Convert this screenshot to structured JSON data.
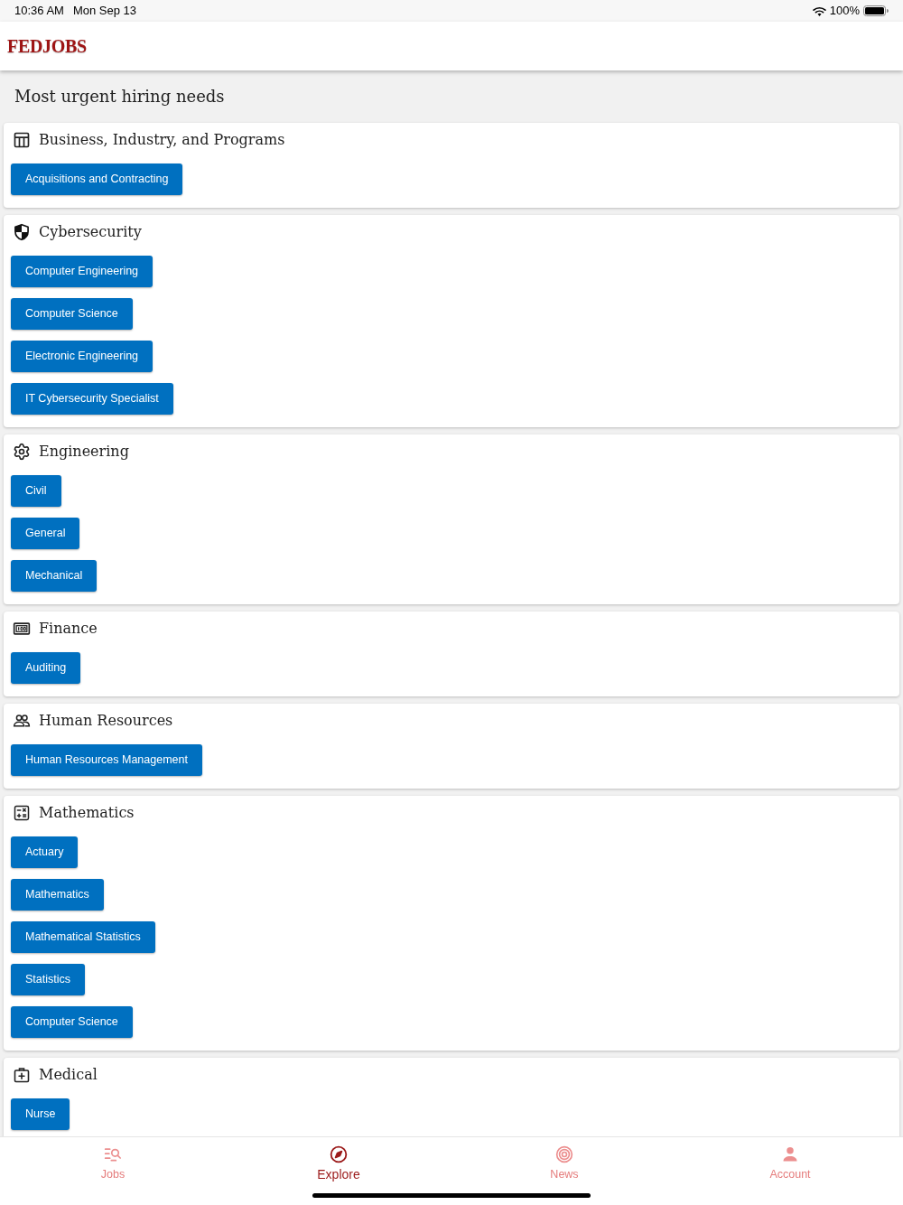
{
  "status_bar": {
    "time": "10:36 AM",
    "date": "Mon Sep 13",
    "battery": "100%"
  },
  "header": {
    "logo": "FEDJOBS"
  },
  "page": {
    "title": "Most urgent hiring needs"
  },
  "categories": [
    {
      "title": "Business, Industry, and Programs",
      "kind": "table",
      "jobs": [
        "Acquisitions and Contracting"
      ]
    },
    {
      "title": "Cybersecurity",
      "kind": "shield",
      "jobs": [
        "Computer Engineering",
        "Computer Science",
        "Electronic Engineering",
        "IT Cybersecurity Specialist"
      ]
    },
    {
      "title": "Engineering",
      "kind": "gear",
      "jobs": [
        "Civil",
        "General",
        "Mechanical"
      ]
    },
    {
      "title": "Finance",
      "kind": "bill",
      "jobs": [
        "Auditing"
      ]
    },
    {
      "title": "Human Resources",
      "kind": "people",
      "jobs": [
        "Human Resources Management"
      ]
    },
    {
      "title": "Mathematics",
      "kind": "calculator",
      "jobs": [
        "Actuary",
        "Mathematics",
        "Mathematical Statistics",
        "Statistics",
        "Computer Science"
      ]
    },
    {
      "title": "Medical",
      "kind": "medkit",
      "jobs": [
        "Nurse"
      ]
    }
  ],
  "tab_bar": [
    {
      "label": "Jobs",
      "kind": "jobs",
      "selected": false
    },
    {
      "label": "Explore",
      "kind": "explore",
      "selected": true
    },
    {
      "label": "News",
      "kind": "news",
      "selected": false
    },
    {
      "label": "Account",
      "kind": "account",
      "selected": false
    }
  ]
}
